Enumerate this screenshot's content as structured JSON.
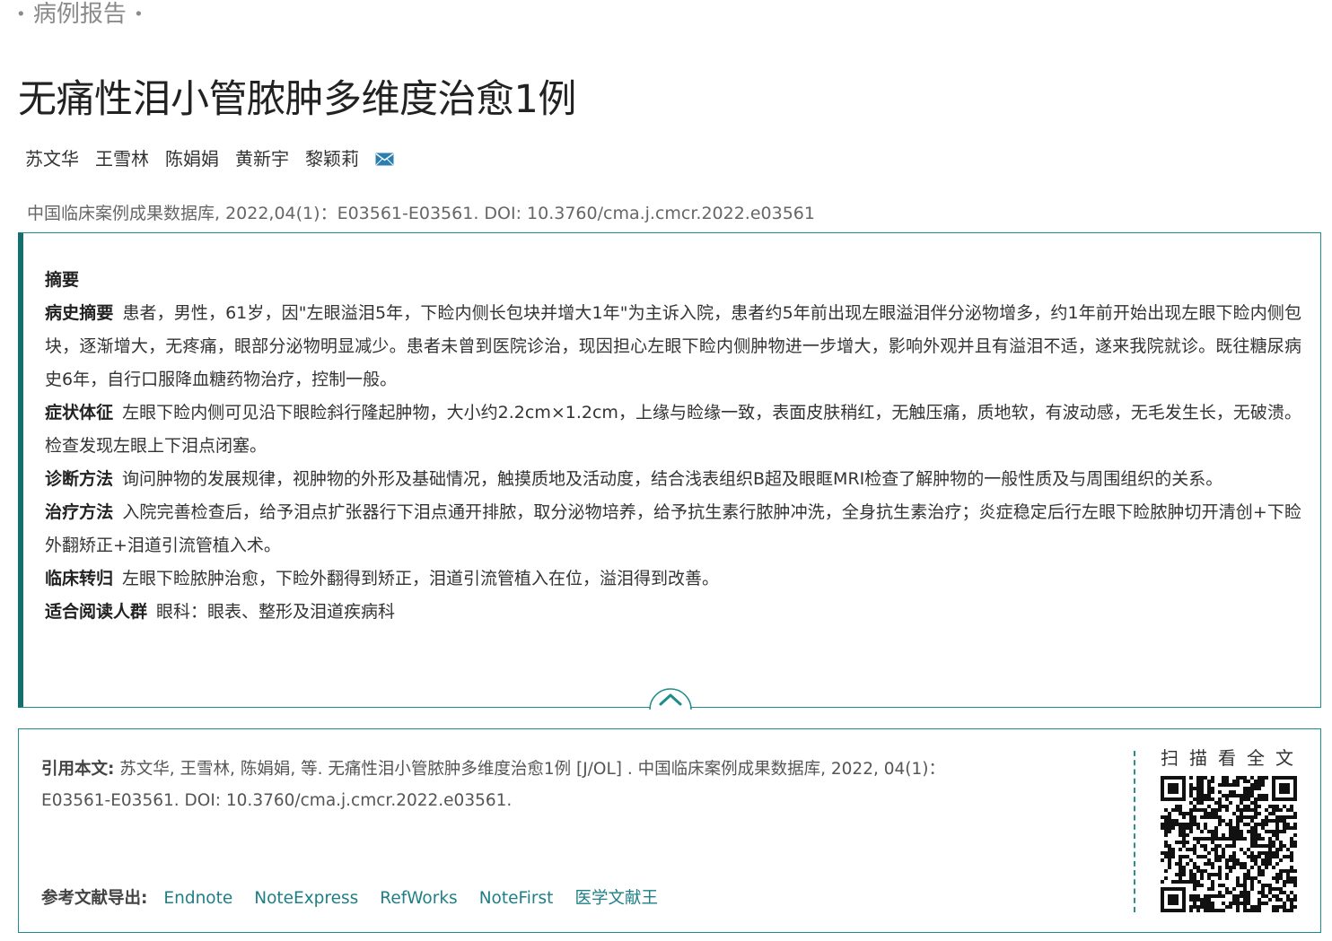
{
  "category": {
    "label": "病例报告",
    "dot": "•"
  },
  "article": {
    "title": "无痛性泪小管脓肿多维度治愈1例",
    "authors": [
      "苏文华",
      "王雪林",
      "陈娟娟",
      "黄新宇",
      "黎颖莉"
    ],
    "corresponding_icon": "mail-icon",
    "source": "中国临床案例成果数据库, 2022,04(1)：E03561-E03561. DOI: 10.3760/cma.j.cmcr.2022.e03561"
  },
  "abstract": {
    "heading": "摘要",
    "sections": [
      {
        "label": "病史摘要",
        "text": "患者，男性，61岁，因\"左眼溢泪5年，下睑内侧长包块并增大1年\"为主诉入院，患者约5年前出现左眼溢泪伴分泌物增多，约1年前开始出现左眼下睑内侧包块，逐渐增大，无疼痛，眼部分泌物明显减少。患者未曾到医院诊治，现因担心左眼下睑内侧肿物进一步增大，影响外观并且有溢泪不适，遂来我院就诊。既往糖尿病史6年，自行口服降血糖药物治疗，控制一般。"
      },
      {
        "label": "症状体征",
        "text": "左眼下睑内侧可见沿下眼睑斜行隆起肿物，大小约2.2cm×1.2cm，上缘与睑缘一致，表面皮肤稍红，无触压痛，质地软，有波动感，无毛发生长，无破溃。检查发现左眼上下泪点闭塞。"
      },
      {
        "label": "诊断方法",
        "text": "询问肿物的发展规律，视肿物的外形及基础情况，触摸质地及活动度，结合浅表组织B超及眼眶MRI检查了解肿物的一般性质及与周围组织的关系。"
      },
      {
        "label": "治疗方法",
        "text": "入院完善检查后，给予泪点扩张器行下泪点通开排脓，取分泌物培养，给予抗生素行脓肿冲洗，全身抗生素治疗；炎症稳定后行左眼下睑脓肿切开清创+下睑外翻矫正+泪道引流管植入术。"
      },
      {
        "label": "临床转归",
        "text": "左眼下睑脓肿治愈，下睑外翻得到矫正，泪道引流管植入在位，溢泪得到改善。"
      },
      {
        "label": "适合阅读人群",
        "text": "眼科：眼表、整形及泪道疾病科"
      }
    ],
    "toggle_icon": "chevron-up-icon"
  },
  "citation": {
    "label": "引用本文:",
    "text": "苏文华, 王雪林, 陈娟娟, 等.  无痛性泪小管脓肿多维度治愈1例 [J/OL] . 中国临床案例成果数据库, 2022, 04(1)：E03561-E03561. DOI: 10.3760/cma.j.cmcr.2022.e03561.",
    "export_label": "参考文献导出:",
    "export_links": [
      "Endnote",
      "NoteExpress",
      "RefWorks",
      "NoteFirst",
      "医学文献王"
    ],
    "qr_label": "扫描看全文"
  },
  "colors": {
    "accent": "#1e8c8c",
    "accent_dark": "#156f6f",
    "link": "#1e7f86",
    "mail": "#2a7fb0"
  }
}
